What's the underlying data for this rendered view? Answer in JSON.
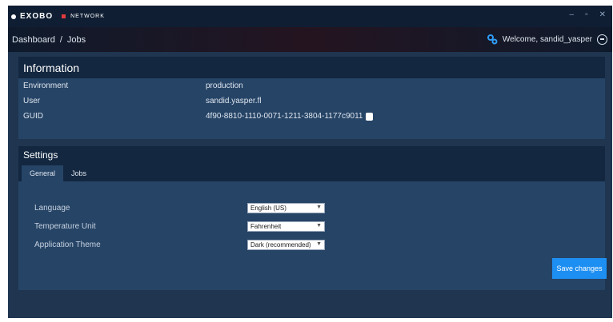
{
  "titlebar": {
    "logo_text": "EXOBO",
    "logo_sub": "NETWORK",
    "controls": [
      "–",
      "▫",
      "✕"
    ]
  },
  "nav": {
    "breadcrumb": [
      "Dashboard",
      "Jobs"
    ],
    "separator": "/",
    "welcome": "Welcome, sandid_yasper"
  },
  "information": {
    "title": "Information",
    "rows": [
      {
        "label": "Environment",
        "value": "production"
      },
      {
        "label": "User",
        "value": "sandid.yasper.fl"
      },
      {
        "label": "GUID",
        "value": "4f90-8810-1110-0071-1211-3804-1177c9011"
      }
    ]
  },
  "settings": {
    "title": "Settings",
    "tabs": [
      "General",
      "Jobs"
    ],
    "active_tab": "General",
    "fields": [
      {
        "label": "Language",
        "value": "English (US)"
      },
      {
        "label": "Temperature Unit",
        "value": "Fahrenheit"
      },
      {
        "label": "Application Theme",
        "value": "Dark (recommended)"
      }
    ],
    "save_label": "Save changes"
  },
  "colors": {
    "window_bg": "#1f3550",
    "panel_bg": "#264466",
    "panel_head": "#132740",
    "accent": "#1e8ff2"
  }
}
